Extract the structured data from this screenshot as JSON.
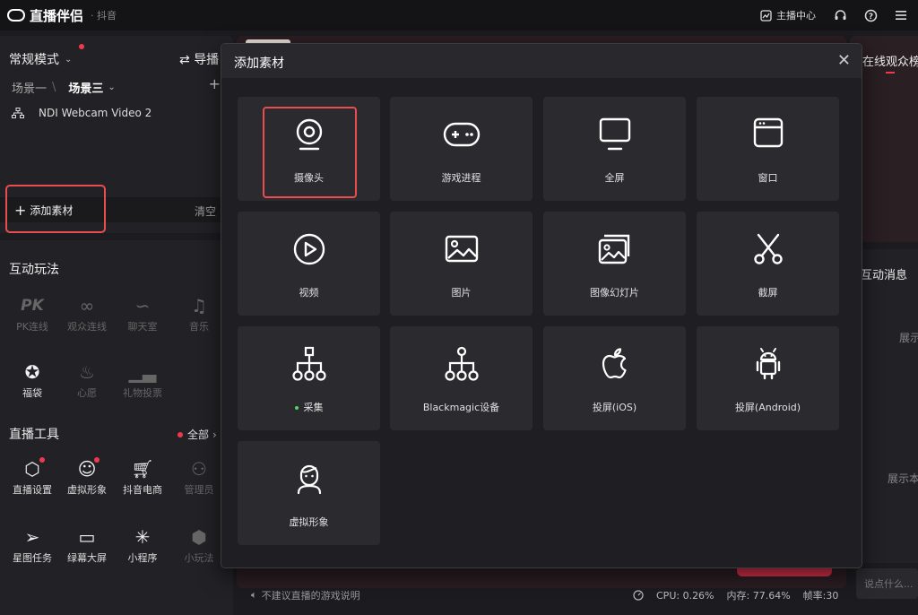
{
  "app": {
    "name": "直播伴侣",
    "platform": "· 抖音"
  },
  "topbar": {
    "creator_center": "主播中心"
  },
  "left": {
    "mode_label": "常规模式",
    "director_label": "导播",
    "scenes": [
      "场景一",
      "场景三"
    ],
    "source_item": "NDI Webcam Video 2",
    "add_material": "添加素材",
    "clear": "清空"
  },
  "interactive": {
    "title": "互动玩法",
    "items": [
      {
        "label": "PK连线"
      },
      {
        "label": "观众连线"
      },
      {
        "label": "聊天室"
      },
      {
        "label": "音乐"
      },
      {
        "label": "福袋"
      },
      {
        "label": "心愿"
      },
      {
        "label": "礼物投票"
      }
    ]
  },
  "tools": {
    "title": "直播工具",
    "all_label": "全部",
    "items": [
      {
        "label": "直播设置"
      },
      {
        "label": "虚拟形象"
      },
      {
        "label": "抖音电商"
      },
      {
        "label": "管理员"
      },
      {
        "label": "星图任务"
      },
      {
        "label": "绿幕大屏"
      },
      {
        "label": "小程序"
      },
      {
        "label": "小玩法"
      }
    ]
  },
  "right": {
    "audience_title": "在线观众榜",
    "messages_title": "互动消息",
    "text1": "展示",
    "text2": "展示本",
    "input_placeholder": "说点什么..."
  },
  "status": {
    "warning": "不建议直播的游戏说明",
    "cpu": "CPU: 0.26%",
    "memory": "内存: 77.64%",
    "fps": "帧率:30"
  },
  "modal": {
    "title": "添加素材",
    "cards": [
      {
        "label": "摄像头",
        "icon": "camera-icon"
      },
      {
        "label": "游戏进程",
        "icon": "gamepad-icon"
      },
      {
        "label": "全屏",
        "icon": "monitor-icon"
      },
      {
        "label": "窗口",
        "icon": "window-icon"
      },
      {
        "label": "视频",
        "icon": "play-icon"
      },
      {
        "label": "图片",
        "icon": "image-icon"
      },
      {
        "label": "图像幻灯片",
        "icon": "slideshow-icon"
      },
      {
        "label": "截屏",
        "icon": "scissors-icon"
      },
      {
        "label": "采集",
        "icon": "capture-tree-icon"
      },
      {
        "label": "Blackmagic设备",
        "icon": "blackmagic-tree-icon"
      },
      {
        "label": "投屏(iOS)",
        "icon": "apple-icon"
      },
      {
        "label": "投屏(Android)",
        "icon": "android-icon"
      },
      {
        "label": "虚拟形象",
        "icon": "avatar-icon"
      }
    ]
  }
}
